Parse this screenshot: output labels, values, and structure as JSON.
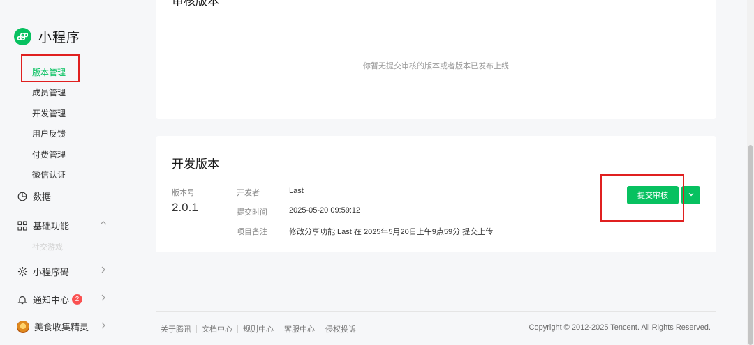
{
  "sidebar": {
    "app_title": "小程序",
    "sub_items": [
      {
        "label": "版本管理",
        "active": true
      },
      {
        "label": "成员管理"
      },
      {
        "label": "开发管理"
      },
      {
        "label": "用户反馈"
      },
      {
        "label": "付费管理"
      },
      {
        "label": "微信认证"
      }
    ],
    "nav": {
      "data": "数据",
      "basic": "基础功能",
      "basic_faded": "社交游戏",
      "qrcode": "小程序码",
      "notify": "通知中心",
      "notify_badge": "2",
      "account": "美食收集精灵"
    }
  },
  "review_card": {
    "title": "审核版本",
    "empty_message": "你暂无提交审核的版本或者版本已发布上线"
  },
  "dev_card": {
    "title": "开发版本",
    "version_label": "版本号",
    "version_value": "2.0.1",
    "developer_label": "开发者",
    "developer_value": "Last",
    "submit_time_label": "提交时间",
    "submit_time_value": "2025-05-20 09:59:12",
    "note_label": "项目备注",
    "note_value": "修改分享功能 Last 在 2025年5月20日上午9点59分 提交上传",
    "submit_button": "提交审核"
  },
  "footer": {
    "links": [
      "关于腾讯",
      "文档中心",
      "规则中心",
      "客服中心",
      "侵权投诉"
    ],
    "copyright": "Copyright © 2012-2025 Tencent. All Rights Reserved."
  },
  "colors": {
    "accent": "#07c160",
    "highlight": "#e02020",
    "badge": "#fa5151"
  }
}
